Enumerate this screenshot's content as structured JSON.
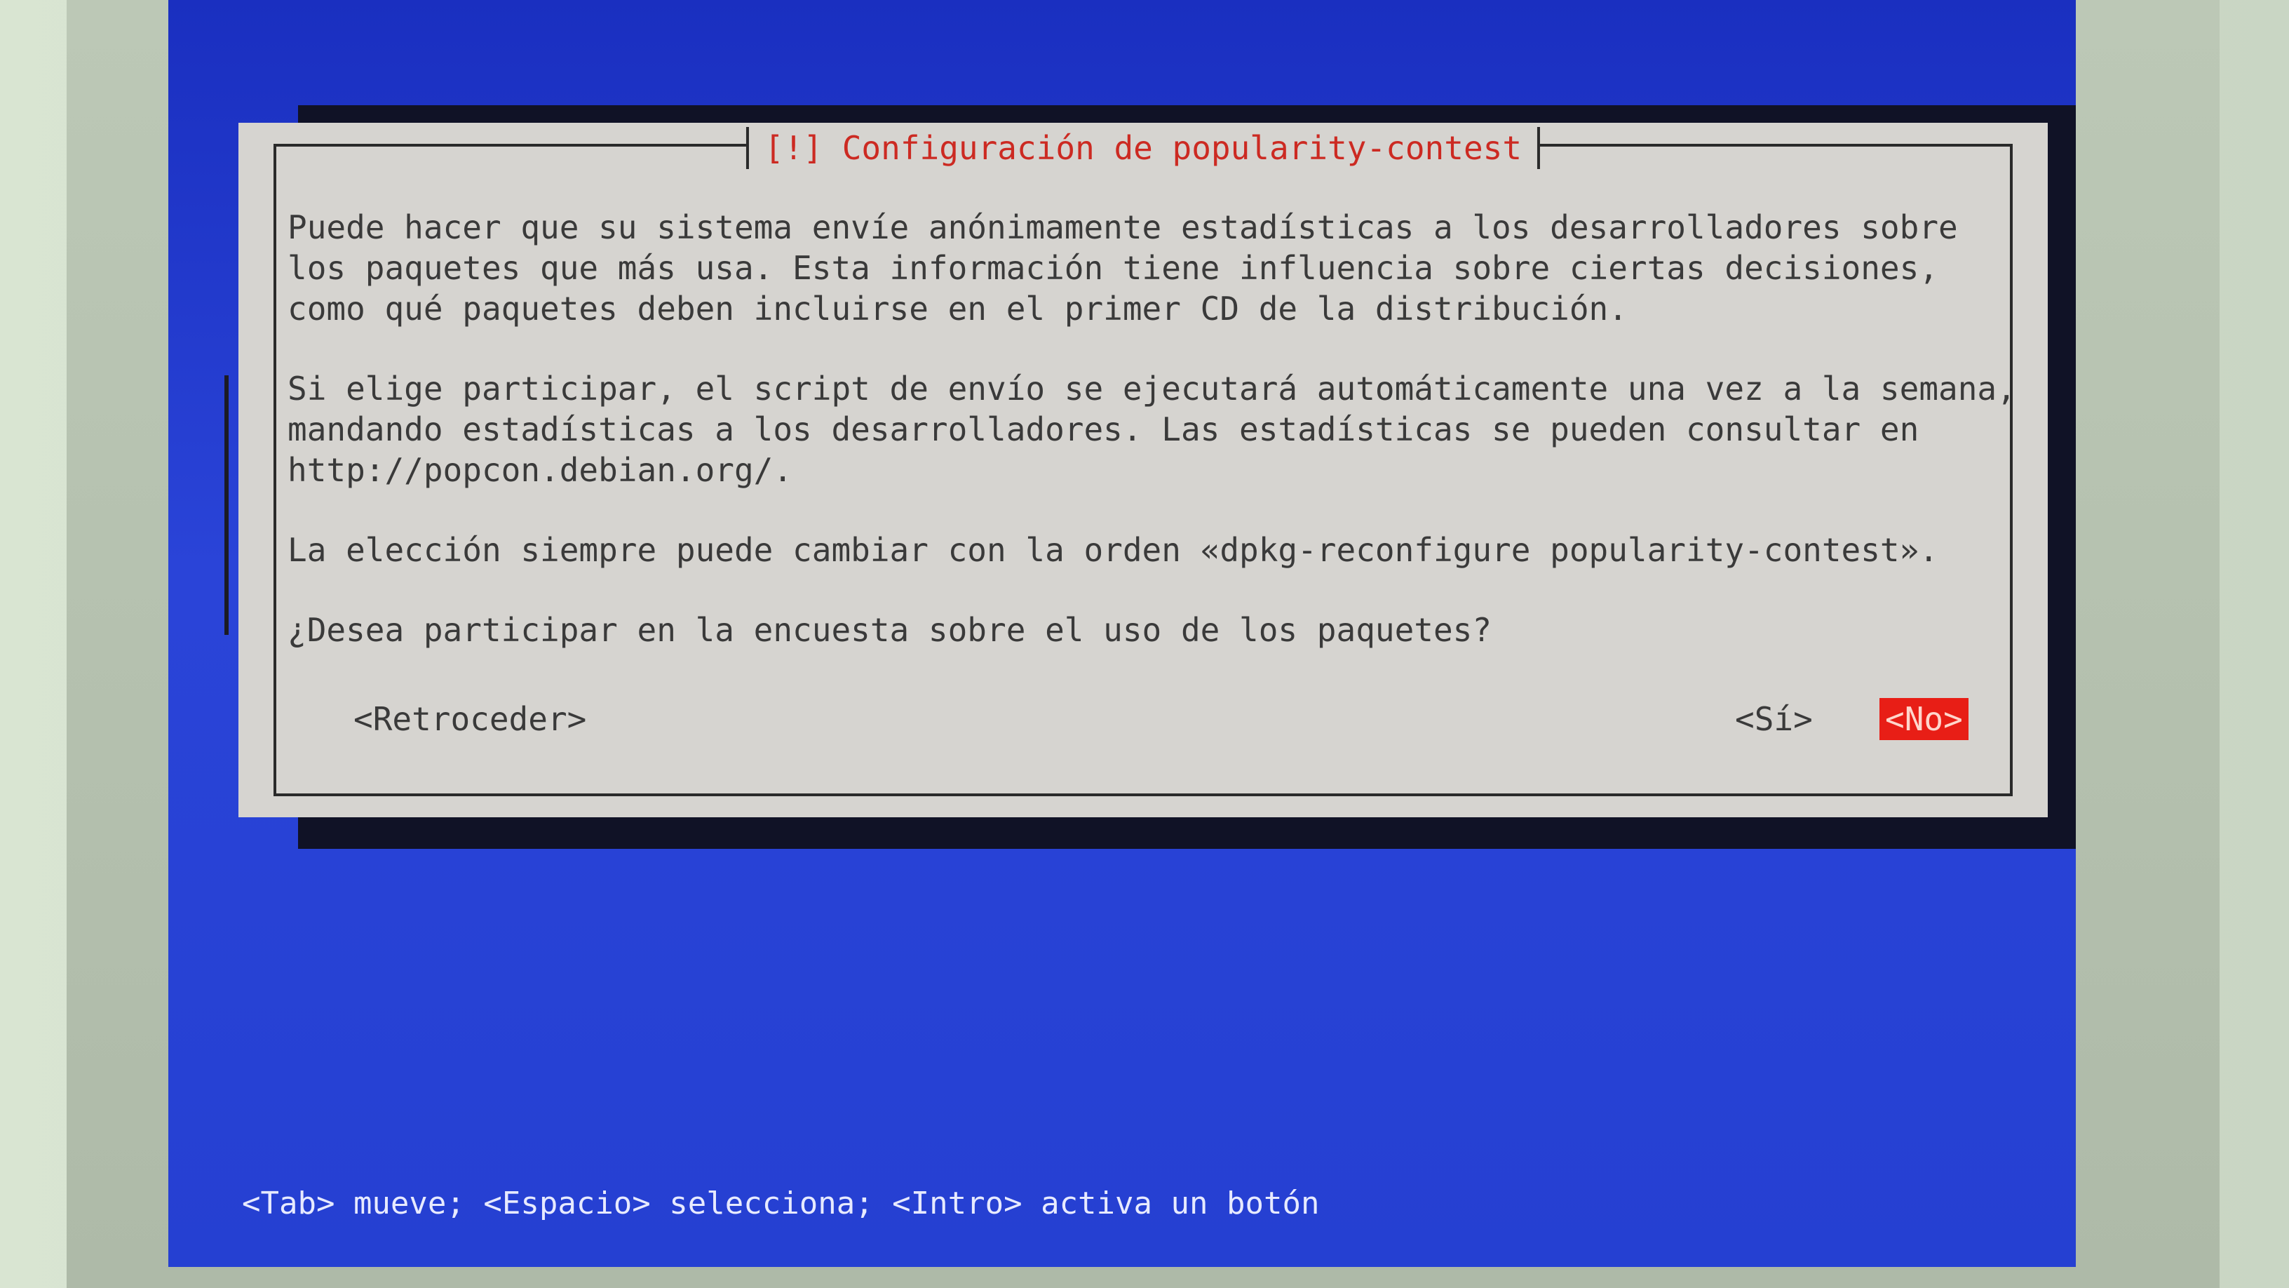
{
  "dialog": {
    "title": "[!] Configuración de popularity-contest",
    "paragraphs": [
      "Puede hacer que su sistema envíe anónimamente estadísticas a los desarrolladores sobre\nlos paquetes que más usa. Esta información tiene influencia sobre ciertas decisiones,\ncomo qué paquetes deben incluirse en el primer CD de la distribución.",
      "Si elige participar, el script de envío se ejecutará automáticamente una vez a la semana,\nmandando estadísticas a los desarrolladores. Las estadísticas se pueden consultar en\nhttp://popcon.debian.org/.",
      "La elección siempre puede cambiar con la orden «dpkg-reconfigure popularity-contest»."
    ],
    "question": "¿Desea participar en la encuesta sobre el uso de los paquetes?",
    "buttons": {
      "back": "<Retroceder>",
      "yes": "<Sí>",
      "no": "<No>"
    }
  },
  "status_bar": "<Tab> mueve; <Espacio> selecciona; <Intro> activa un botón",
  "colors": {
    "screen_background": "#2540d2",
    "dialog_background": "#d6d4d0",
    "title_color": "#cc2a22",
    "selected_button": "#e81e16"
  }
}
